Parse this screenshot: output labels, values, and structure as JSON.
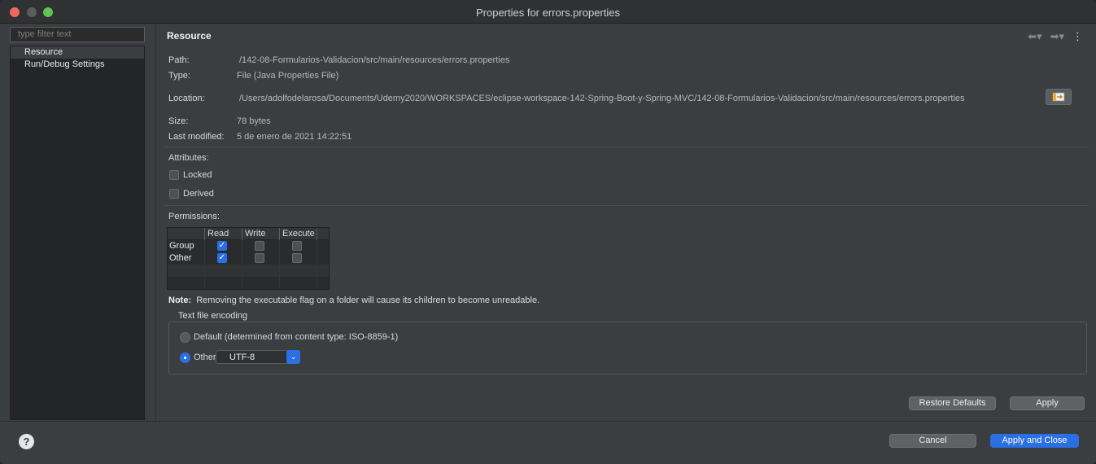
{
  "window": {
    "title": "Properties for errors.properties"
  },
  "sidebar": {
    "filter_placeholder": "type filter text",
    "items": [
      {
        "label": "Resource",
        "selected": true
      },
      {
        "label": "Run/Debug Settings",
        "selected": false
      }
    ]
  },
  "page": {
    "title": "Resource",
    "fields": {
      "path_label": "Path:",
      "path_value": "/142-08-Formularios-Validacion/src/main/resources/errors.properties",
      "type_label": "Type:",
      "type_value": "File  (Java Properties File)",
      "location_label": "Location:",
      "location_value": "/Users/adolfodelarosa/Documents/Udemy2020/WORKSPACES/eclipse-workspace-142-Spring-Boot-y-Spring-MVC/142-08-Formularios-Validacion/src/main/resources/errors.properties",
      "size_label": "Size:",
      "size_value": "78  bytes",
      "modified_label": "Last modified:",
      "modified_value": "5 de enero de 2021 14:22:51"
    },
    "attributes": {
      "label": "Attributes:",
      "locked_label": "Locked",
      "locked": false,
      "derived_label": "Derived",
      "derived": false
    },
    "permissions": {
      "label": "Permissions:",
      "columns": [
        "Read",
        "Write",
        "Execute"
      ],
      "rows": [
        {
          "label": "Group",
          "read": true,
          "write": false,
          "execute": false
        },
        {
          "label": "Other",
          "read": true,
          "write": false,
          "execute": false
        }
      ]
    },
    "note": {
      "bold": "Note:",
      "text": "Removing the executable flag on a folder will cause its children to become unreadable."
    },
    "encoding": {
      "title": "Text file encoding",
      "default_label": "Default (determined from content type: ISO-8859-1)",
      "other_label": "Other:",
      "other_value": "UTF-8",
      "selected": "other"
    },
    "buttons": {
      "restore_defaults": "Restore Defaults",
      "apply": "Apply"
    }
  },
  "footer": {
    "help": "?",
    "cancel": "Cancel",
    "apply_and_close": "Apply and Close"
  },
  "colors": {
    "accent": "#2a6fe3",
    "close": "#ed6a5e",
    "maximize": "#61c554"
  }
}
